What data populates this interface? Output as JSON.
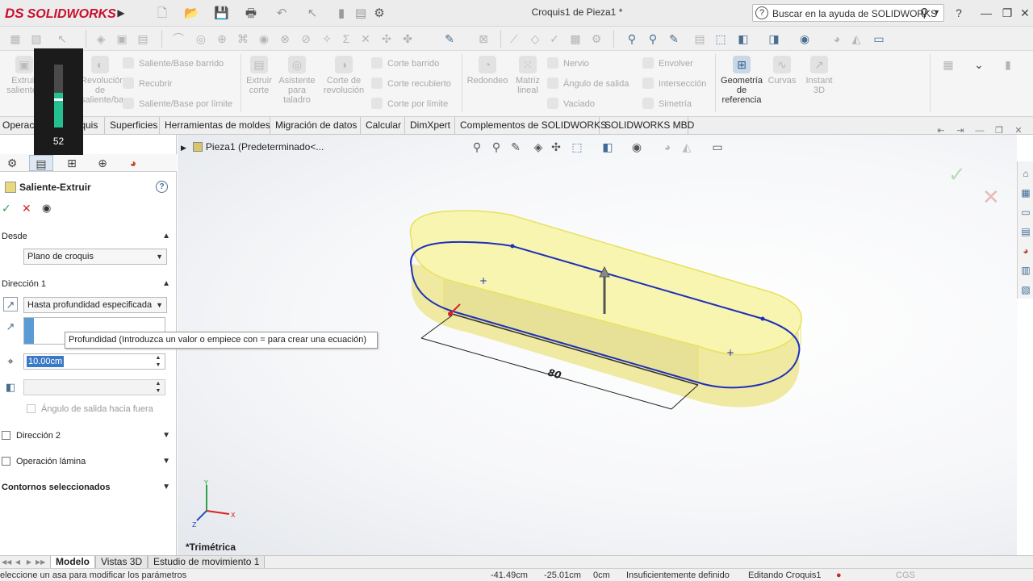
{
  "window": {
    "app_name": "SOLIDWORKS",
    "doc_title": "Croquis1 de Pieza1 *",
    "help_search_placeholder": "Buscar en la ayuda de SOLIDWORKS"
  },
  "ribbon": {
    "extruir_saliente": "Extruir saliente/base",
    "revolucion_saliente": "Revolución de saliente/base",
    "saliente_barrido": "Saliente/Base barrido",
    "recubrir": "Recubrir",
    "saliente_limite": "Saliente/Base por límite",
    "extruir_corte": "Extruir corte",
    "asistente_taladro": "Asistente para taladro",
    "corte_revolucion": "Corte de revolución",
    "corte_barrido": "Corte barrido",
    "corte_recubierto": "Corte recubierto",
    "corte_limite": "Corte por límite",
    "redondeo": "Redondeo",
    "matriz_lineal": "Matriz lineal",
    "nervio": "Nervio",
    "angulo_salida": "Ángulo de salida",
    "vaciado": "Vaciado",
    "envolver": "Envolver",
    "interseccion": "Intersección",
    "simetria": "Simetría",
    "geometria_referencia": "Geometría de referencia",
    "curvas": "Curvas",
    "instant3d": "Instant 3D"
  },
  "tabs": [
    "Operaciones",
    "Croquis",
    "Superficies",
    "Herramientas de moldes",
    "Migración de datos",
    "Calcular",
    "DimXpert",
    "Complementos de SOLIDWORKS",
    "SOLIDWORKS MBD"
  ],
  "property_manager": {
    "feature_title": "Saliente-Extruir",
    "desde_label": "Desde",
    "desde_value": "Plano de croquis",
    "direccion1_label": "Dirección 1",
    "end_condition": "Hasta profundidad especificada",
    "depth_value": "10.00cm",
    "draft_outward_label": "Ángulo de salida hacia fuera",
    "direccion2_label": "Dirección 2",
    "operacion_lamina_label": "Operación lámina",
    "contornos_label": "Contornos seleccionados"
  },
  "tooltip": "Profundidad (Introduzca un valor o empiece con = para crear una ecuación)",
  "viewport": {
    "breadcrumb": "Pieza1  (Predeterminado<...",
    "dimension_label": "80",
    "view_orientation": "*Trimétrica",
    "triad": {
      "x": "X",
      "y": "Y",
      "z": "Z"
    }
  },
  "bottom_tabs": [
    "Modelo",
    "Vistas 3D",
    "Estudio de movimiento 1"
  ],
  "statusbar": {
    "message": "eleccione un asa para modificar los parámetros",
    "x": "-41.49cm",
    "y": "-25.01cm",
    "z": "0cm",
    "definition": "Insuficientemente definido",
    "editing": "Editando Croquis1",
    "units": "CGS"
  },
  "overlay": {
    "value": "52",
    "level": 0.55
  },
  "colors": {
    "brand_red": "#c8102e",
    "sketch_blue": "#1f2fb8",
    "preview_yellow": "#f7f5b0",
    "accent_blue": "#3a78c8"
  }
}
